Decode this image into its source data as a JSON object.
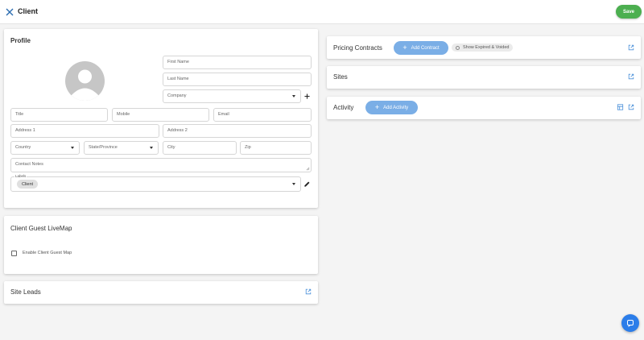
{
  "header": {
    "title": "Client",
    "save_label": "Save"
  },
  "profile": {
    "title": "Profile",
    "fields": {
      "first_name": "First Name",
      "last_name": "Last Name",
      "company": "Company",
      "title": "Title",
      "mobile": "Mobile",
      "email": "Email",
      "address1": "Address 1",
      "address2": "Address 2",
      "country": "Country",
      "state": "State/Province",
      "city": "City",
      "zip": "Zip",
      "contact_notes": "Contact Notes",
      "labels": "Labels"
    },
    "label_chip": "Client"
  },
  "livemap": {
    "title": "Client Guest LiveMap",
    "checkbox_label": "Enable Client Guest Map"
  },
  "site_leads": {
    "title": "Site Leads"
  },
  "pricing": {
    "title": "Pricing Contracts",
    "add_label": "Add Contract",
    "show_label": "Show Expired & Voided"
  },
  "sites": {
    "title": "Sites"
  },
  "activity": {
    "title": "Activity",
    "add_label": "Add Activity"
  },
  "icons": {
    "close": "close-icon",
    "open": "open-in-new-icon",
    "edit": "pencil-icon",
    "add": "plus-icon",
    "table": "table-view-icon",
    "chat": "chat-icon"
  },
  "colors": {
    "save": "#4caf50",
    "pill": "#7aaee6",
    "icon_blue": "#4a90d9",
    "fab": "#2b7de9"
  }
}
